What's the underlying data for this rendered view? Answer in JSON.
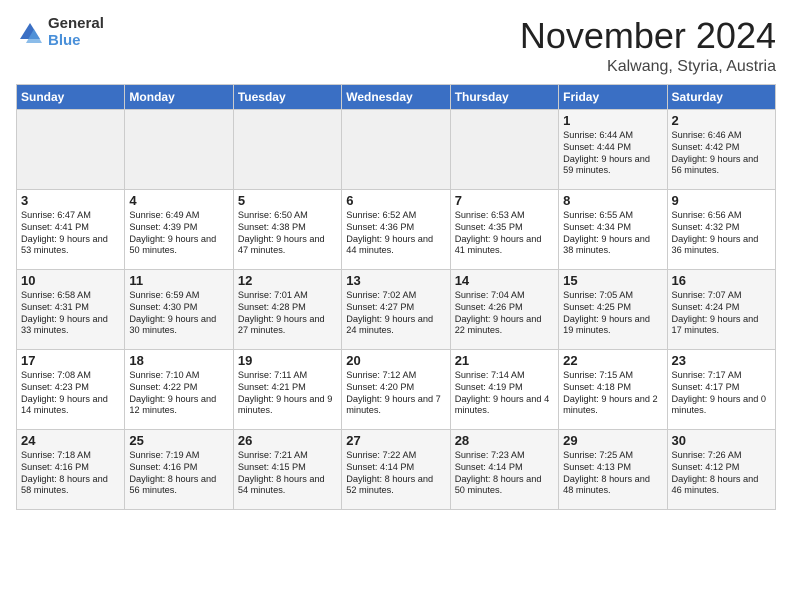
{
  "header": {
    "logo_line1": "General",
    "logo_line2": "Blue",
    "month_title": "November 2024",
    "location": "Kalwang, Styria, Austria"
  },
  "weekdays": [
    "Sunday",
    "Monday",
    "Tuesday",
    "Wednesday",
    "Thursday",
    "Friday",
    "Saturday"
  ],
  "weeks": [
    [
      {
        "day": "",
        "info": ""
      },
      {
        "day": "",
        "info": ""
      },
      {
        "day": "",
        "info": ""
      },
      {
        "day": "",
        "info": ""
      },
      {
        "day": "",
        "info": ""
      },
      {
        "day": "1",
        "info": "Sunrise: 6:44 AM\nSunset: 4:44 PM\nDaylight: 9 hours and 59 minutes."
      },
      {
        "day": "2",
        "info": "Sunrise: 6:46 AM\nSunset: 4:42 PM\nDaylight: 9 hours and 56 minutes."
      }
    ],
    [
      {
        "day": "3",
        "info": "Sunrise: 6:47 AM\nSunset: 4:41 PM\nDaylight: 9 hours and 53 minutes."
      },
      {
        "day": "4",
        "info": "Sunrise: 6:49 AM\nSunset: 4:39 PM\nDaylight: 9 hours and 50 minutes."
      },
      {
        "day": "5",
        "info": "Sunrise: 6:50 AM\nSunset: 4:38 PM\nDaylight: 9 hours and 47 minutes."
      },
      {
        "day": "6",
        "info": "Sunrise: 6:52 AM\nSunset: 4:36 PM\nDaylight: 9 hours and 44 minutes."
      },
      {
        "day": "7",
        "info": "Sunrise: 6:53 AM\nSunset: 4:35 PM\nDaylight: 9 hours and 41 minutes."
      },
      {
        "day": "8",
        "info": "Sunrise: 6:55 AM\nSunset: 4:34 PM\nDaylight: 9 hours and 38 minutes."
      },
      {
        "day": "9",
        "info": "Sunrise: 6:56 AM\nSunset: 4:32 PM\nDaylight: 9 hours and 36 minutes."
      }
    ],
    [
      {
        "day": "10",
        "info": "Sunrise: 6:58 AM\nSunset: 4:31 PM\nDaylight: 9 hours and 33 minutes."
      },
      {
        "day": "11",
        "info": "Sunrise: 6:59 AM\nSunset: 4:30 PM\nDaylight: 9 hours and 30 minutes."
      },
      {
        "day": "12",
        "info": "Sunrise: 7:01 AM\nSunset: 4:28 PM\nDaylight: 9 hours and 27 minutes."
      },
      {
        "day": "13",
        "info": "Sunrise: 7:02 AM\nSunset: 4:27 PM\nDaylight: 9 hours and 24 minutes."
      },
      {
        "day": "14",
        "info": "Sunrise: 7:04 AM\nSunset: 4:26 PM\nDaylight: 9 hours and 22 minutes."
      },
      {
        "day": "15",
        "info": "Sunrise: 7:05 AM\nSunset: 4:25 PM\nDaylight: 9 hours and 19 minutes."
      },
      {
        "day": "16",
        "info": "Sunrise: 7:07 AM\nSunset: 4:24 PM\nDaylight: 9 hours and 17 minutes."
      }
    ],
    [
      {
        "day": "17",
        "info": "Sunrise: 7:08 AM\nSunset: 4:23 PM\nDaylight: 9 hours and 14 minutes."
      },
      {
        "day": "18",
        "info": "Sunrise: 7:10 AM\nSunset: 4:22 PM\nDaylight: 9 hours and 12 minutes."
      },
      {
        "day": "19",
        "info": "Sunrise: 7:11 AM\nSunset: 4:21 PM\nDaylight: 9 hours and 9 minutes."
      },
      {
        "day": "20",
        "info": "Sunrise: 7:12 AM\nSunset: 4:20 PM\nDaylight: 9 hours and 7 minutes."
      },
      {
        "day": "21",
        "info": "Sunrise: 7:14 AM\nSunset: 4:19 PM\nDaylight: 9 hours and 4 minutes."
      },
      {
        "day": "22",
        "info": "Sunrise: 7:15 AM\nSunset: 4:18 PM\nDaylight: 9 hours and 2 minutes."
      },
      {
        "day": "23",
        "info": "Sunrise: 7:17 AM\nSunset: 4:17 PM\nDaylight: 9 hours and 0 minutes."
      }
    ],
    [
      {
        "day": "24",
        "info": "Sunrise: 7:18 AM\nSunset: 4:16 PM\nDaylight: 8 hours and 58 minutes."
      },
      {
        "day": "25",
        "info": "Sunrise: 7:19 AM\nSunset: 4:16 PM\nDaylight: 8 hours and 56 minutes."
      },
      {
        "day": "26",
        "info": "Sunrise: 7:21 AM\nSunset: 4:15 PM\nDaylight: 8 hours and 54 minutes."
      },
      {
        "day": "27",
        "info": "Sunrise: 7:22 AM\nSunset: 4:14 PM\nDaylight: 8 hours and 52 minutes."
      },
      {
        "day": "28",
        "info": "Sunrise: 7:23 AM\nSunset: 4:14 PM\nDaylight: 8 hours and 50 minutes."
      },
      {
        "day": "29",
        "info": "Sunrise: 7:25 AM\nSunset: 4:13 PM\nDaylight: 8 hours and 48 minutes."
      },
      {
        "day": "30",
        "info": "Sunrise: 7:26 AM\nSunset: 4:12 PM\nDaylight: 8 hours and 46 minutes."
      }
    ]
  ]
}
